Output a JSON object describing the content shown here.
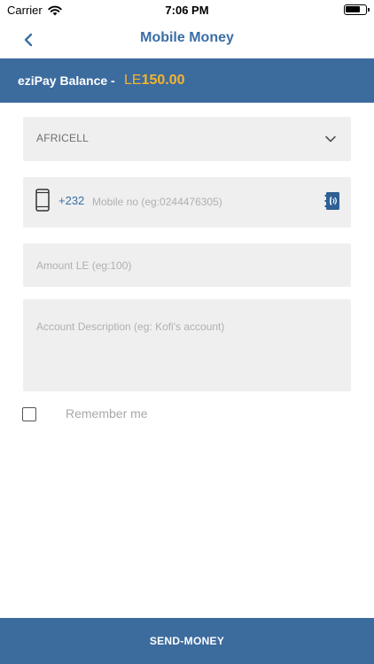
{
  "status_bar": {
    "carrier": "Carrier",
    "time": "7:06 PM",
    "icons": [
      "wifi-icon",
      "battery-icon"
    ]
  },
  "nav": {
    "title": "Mobile Money",
    "back_icon": "chevron-left-icon"
  },
  "balance": {
    "label": "eziPay Balance -",
    "currency": "LE",
    "amount": "150.00"
  },
  "form": {
    "network": {
      "selected": "AFRICELL",
      "icon": "chevron-down-icon"
    },
    "phone": {
      "dial_code": "+232",
      "placeholder": "Mobile no (eg:0244476305)",
      "value": "",
      "icons": [
        "mobile-phone-icon",
        "contacts-book-icon"
      ]
    },
    "amount": {
      "placeholder": "Amount LE (eg:100)",
      "value": ""
    },
    "description": {
      "placeholder": "Account Description (eg: Kofi's account)",
      "value": ""
    },
    "remember": {
      "label": "Remember me",
      "checked": false
    }
  },
  "actions": {
    "send_label": "SEND-MONEY"
  },
  "colors": {
    "primary": "#3c6b9e",
    "title_blue": "#3a6ea5",
    "balance_gold": "#f4b52d",
    "field_bg": "#efefef"
  }
}
